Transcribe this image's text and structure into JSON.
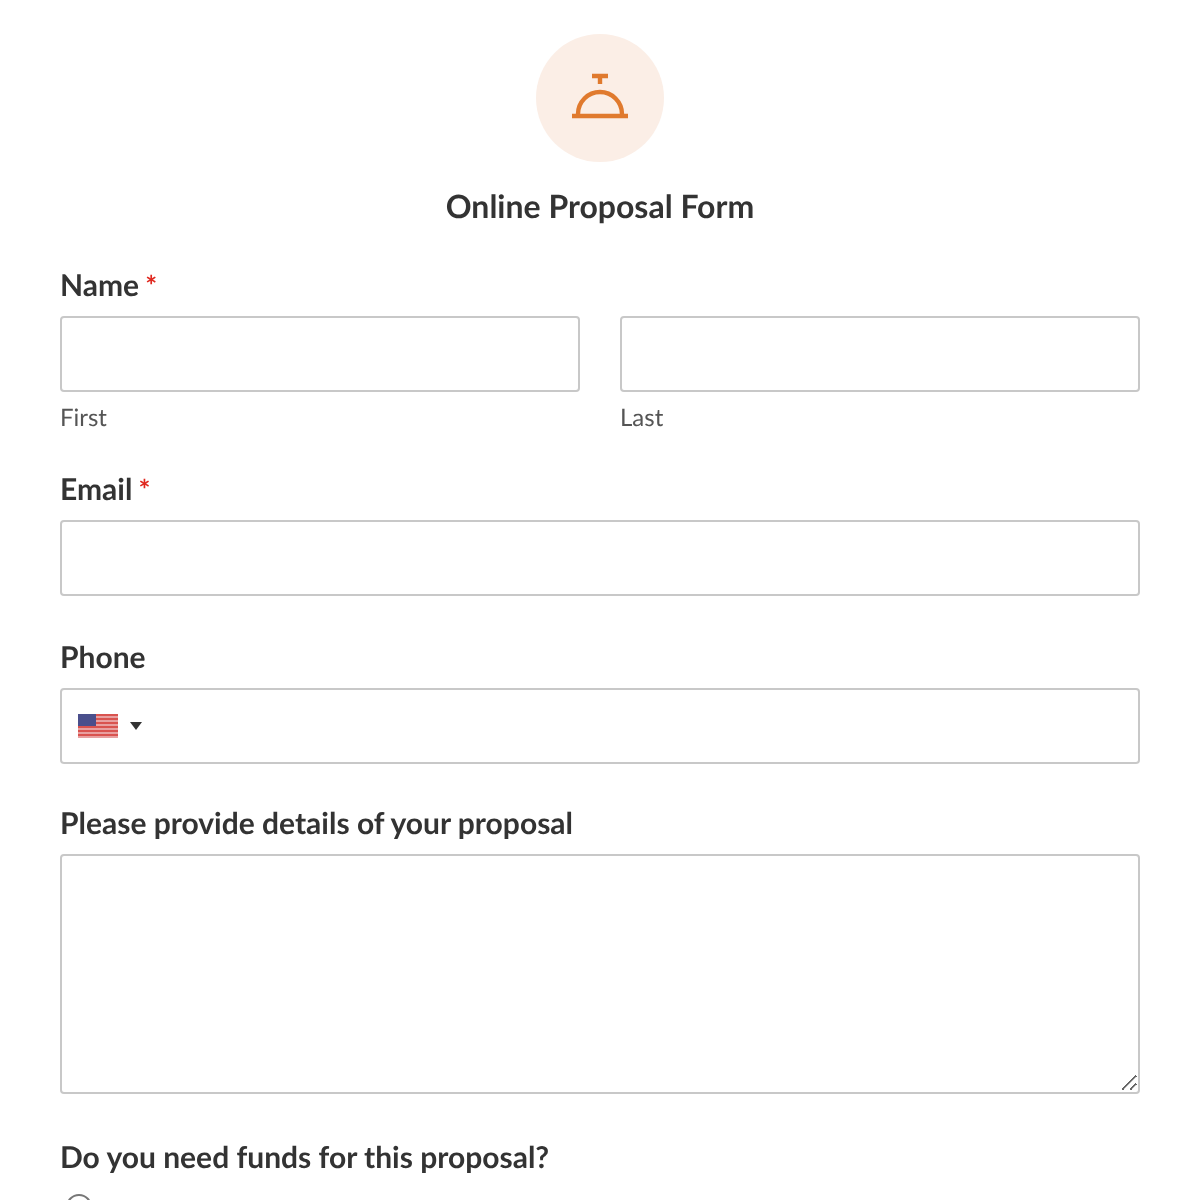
{
  "form": {
    "title": "Online Proposal Form"
  },
  "name": {
    "label": "Name",
    "required_mark": "*",
    "sublabels": [
      "First",
      "Last"
    ]
  },
  "email": {
    "label": "Email",
    "required_mark": "*"
  },
  "phone": {
    "label": "Phone"
  },
  "details": {
    "label": "Please provide details of your proposal"
  },
  "funds": {
    "label": "Do you need funds for this proposal?",
    "options": [
      {
        "selected": false
      }
    ]
  }
}
